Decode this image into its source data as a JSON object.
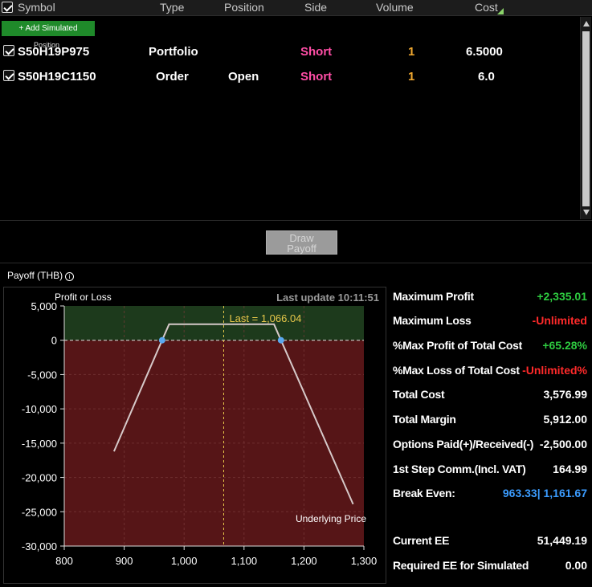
{
  "table": {
    "headers": {
      "symbol": "Symbol",
      "type": "Type",
      "position": "Position",
      "side": "Side",
      "volume": "Volume",
      "cost": "Cost"
    },
    "add_simulated_label": "+ Add Simulated",
    "add_simulated_sub": "Position",
    "rows": [
      {
        "checked": true,
        "symbol": "S50H19P975",
        "type": "Portfolio",
        "position": "",
        "side": "Short",
        "volume": "1",
        "cost": "6.5000"
      },
      {
        "checked": true,
        "symbol": "S50H19C1150",
        "type": "Order",
        "position": "Open",
        "side": "Short",
        "volume": "1",
        "cost": "6.0"
      }
    ]
  },
  "draw_payoff": {
    "line1": "Draw",
    "line2": "Payoff"
  },
  "payoff": {
    "title": "Payoff (THB)",
    "info_icon": "info-icon",
    "last_update": "Last update 10:11:51"
  },
  "chart_data": {
    "type": "line",
    "ylabel": "Profit or Loss",
    "xlabel": "Underlying Price",
    "xlim": [
      800,
      1300
    ],
    "ylim": [
      -30000,
      5000
    ],
    "x_ticks": [
      "800",
      "900",
      "1,000",
      "1,100",
      "1,200",
      "1,300"
    ],
    "y_ticks": [
      "5,000",
      "0",
      "-5,000",
      "-10,000",
      "-15,000",
      "-20,000",
      "-25,000",
      "-30,000"
    ],
    "x_tick_values": [
      800,
      900,
      1000,
      1100,
      1200,
      1300
    ],
    "y_tick_values": [
      5000,
      0,
      -5000,
      -10000,
      -15000,
      -20000,
      -25000,
      -30000
    ],
    "series": [
      {
        "x": [
          883,
          963.33,
          975,
          1150,
          1161.67,
          1282
        ],
        "y": [
          -16200,
          0,
          2335.01,
          2335.01,
          0,
          -23900
        ]
      }
    ],
    "breakeven_x": [
      963.33,
      1161.67
    ],
    "last_value": 1066.04,
    "last_label": "Last = 1,066.04",
    "colors": {
      "profit_zone": "#1d3a1c",
      "loss_zone": "#561517",
      "line": "#d6c9c9",
      "last": "#e8c84a",
      "breakeven": "#5aa8f0"
    },
    "grid": true
  },
  "stats": [
    {
      "label": "Maximum Profit",
      "value": "+2,335.01",
      "tone": "pos"
    },
    {
      "label": "Maximum Loss",
      "value": "-Unlimited",
      "tone": "neg"
    },
    {
      "label": "%Max Profit of Total Cost",
      "value": "+65.28%",
      "tone": "pos"
    },
    {
      "label": "%Max Loss of Total Cost",
      "value": "-Unlimited%",
      "tone": "neg"
    },
    {
      "label": "Total Cost",
      "value": "3,576.99",
      "tone": ""
    },
    {
      "label": "Total Margin",
      "value": "5,912.00",
      "tone": ""
    },
    {
      "label": "Options Paid(+)/Received(-)",
      "value": "-2,500.00",
      "tone": ""
    },
    {
      "label": "1st Step Comm.(Incl. VAT)",
      "value": "164.99",
      "tone": ""
    },
    {
      "label": "Break Even:",
      "value": "963.33| 1,161.67",
      "tone": "be"
    },
    {
      "label": "Current EE",
      "value": "51,449.19",
      "tone": ""
    },
    {
      "label": "Required EE for Simulated",
      "value": "0.00",
      "tone": ""
    }
  ]
}
